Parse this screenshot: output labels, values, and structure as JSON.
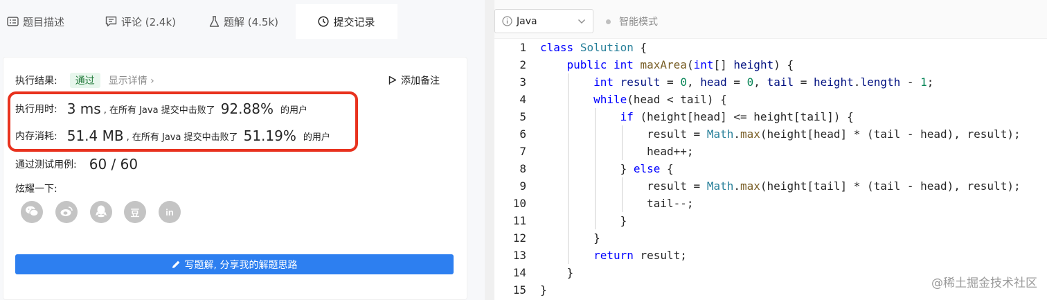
{
  "tabs": [
    {
      "label": "题目描述",
      "icon": "list-icon"
    },
    {
      "label": "评论 (2.4k)",
      "icon": "comment-icon"
    },
    {
      "label": "题解 (4.5k)",
      "icon": "flask-icon"
    },
    {
      "label": "提交记录",
      "icon": "clock-icon",
      "active": true
    }
  ],
  "result": {
    "label": "执行结果:",
    "status": "通过",
    "details_link": "显示详情 ›",
    "add_note": "添加备注"
  },
  "runtime": {
    "label": "执行用时:",
    "value": "3 ms",
    "beat_text": ", 在所有 Java 提交中击败了",
    "percent": "92.88%",
    "suffix": "的用户"
  },
  "memory": {
    "label": "内存消耗:",
    "value": "51.4 MB",
    "beat_text": ", 在所有 Java 提交中击败了",
    "percent": "51.19%",
    "suffix": "的用户"
  },
  "test_cases": {
    "label": "通过测试用例:",
    "value": "60 / 60"
  },
  "share": {
    "label": "炫耀一下:",
    "buttons": [
      {
        "icon": "wechat-icon",
        "glyph": ""
      },
      {
        "icon": "weibo-icon",
        "glyph": ""
      },
      {
        "icon": "qq-icon",
        "glyph": ""
      },
      {
        "icon": "douban-icon",
        "glyph": "豆"
      },
      {
        "icon": "linkedin-icon",
        "glyph": "in"
      }
    ]
  },
  "write_button": "写题解, 分享我的解题思路",
  "editor": {
    "language": "Java",
    "smart_mode": "智能模式",
    "line_numbers": [
      "1",
      "2",
      "3",
      "4",
      "5",
      "6",
      "7",
      "8",
      "9",
      "10",
      "11",
      "12",
      "13",
      "14",
      "15"
    ]
  },
  "watermark": "@稀土掘金技术社区",
  "colors": {
    "accent": "#2d7ff0",
    "highlight": "#e8321e",
    "success_bg": "#e7f6ec",
    "success_text": "#237b3b",
    "keyword": "#0000ff",
    "class": "#267f99",
    "method": "#795e26",
    "number": "#098658"
  }
}
